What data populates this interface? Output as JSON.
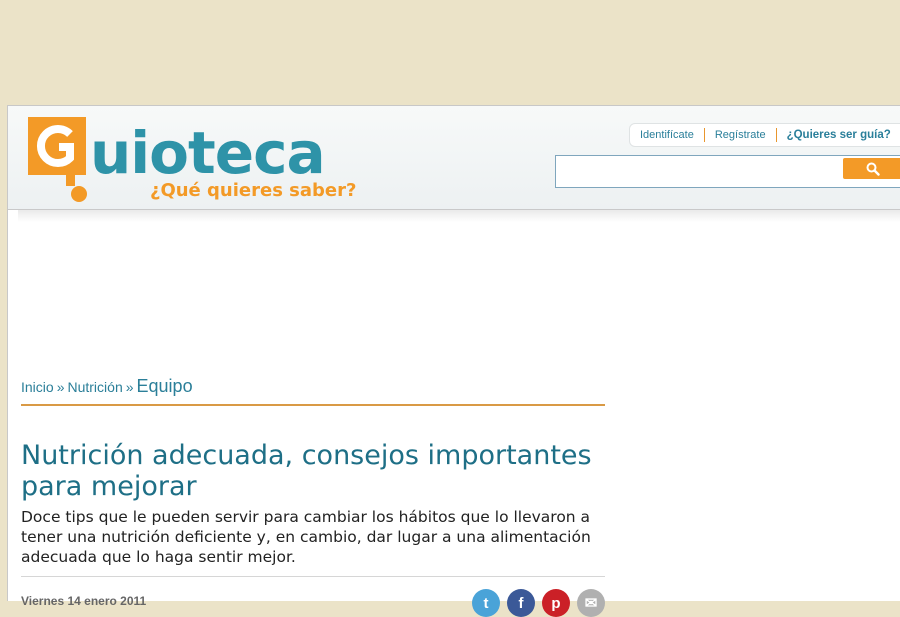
{
  "brand": {
    "name": "Guioteca",
    "tagline": "¿Qué quieres saber?"
  },
  "user_links": {
    "login": "Identifícate",
    "register": "Regístrate",
    "guide": "¿Quieres ser guía?"
  },
  "search": {
    "placeholder": "",
    "button_icon": "search-icon"
  },
  "breadcrumb": {
    "home": "Inicio",
    "separator": "»",
    "category": "Nutrición",
    "current": "Equipo"
  },
  "article": {
    "title": "Nutrición adecuada, consejos importantes para mejorar",
    "subtitle": "Doce tips que le pueden servir para cambiar los hábitos que lo llevaron a tener una nutrición deficiente y, en cambio, dar lugar a una alimentación adecuada que lo haga sentir mejor.",
    "date": "Viernes 14 enero 2011"
  },
  "share_buttons": [
    {
      "name": "twitter",
      "icon": "twitter-icon",
      "color": "#4aa3d8"
    },
    {
      "name": "facebook",
      "icon": "facebook-icon",
      "color": "#3b5998"
    },
    {
      "name": "pinterest",
      "icon": "pinterest-icon",
      "color": "#cb2027"
    },
    {
      "name": "email",
      "icon": "email-icon",
      "color": "#b0b0b0"
    }
  ],
  "colors": {
    "background": "#ebe3c8",
    "brand_orange": "#f39a27",
    "brand_teal": "#2a8fa3",
    "link": "#2b7f99",
    "title": "#1e6f86"
  }
}
